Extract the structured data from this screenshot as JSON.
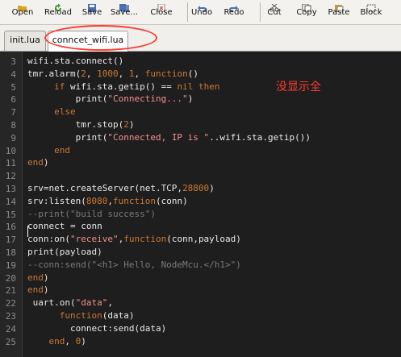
{
  "toolbar": {
    "buttons": [
      {
        "label": "Open",
        "icon": "folder-open-icon",
        "color": "#d9a520"
      },
      {
        "label": "Reload",
        "icon": "reload-icon",
        "color": "#3aa038"
      },
      {
        "label": "Save",
        "icon": "floppy-icon",
        "color": "#4a6fb0"
      },
      {
        "label": "Save...",
        "icon": "floppy-multi-icon",
        "color": "#4a6fb0"
      },
      {
        "label": "Close",
        "icon": "close-icon",
        "color": "#888888"
      },
      {
        "label": "Undo",
        "icon": "undo-icon",
        "color": "#4a6fb0"
      },
      {
        "label": "Redo",
        "icon": "redo-icon",
        "color": "#4a6fb0"
      },
      {
        "label": "Cut",
        "icon": "scissors-icon",
        "color": "#555555"
      },
      {
        "label": "Copy",
        "icon": "copy-icon",
        "color": "#555555"
      },
      {
        "label": "Paste",
        "icon": "paste-icon",
        "color": "#c99a3c"
      },
      {
        "label": "Block",
        "icon": "block-icon",
        "color": "#555555"
      }
    ]
  },
  "tabs": [
    {
      "label": "init.lua",
      "active": false
    },
    {
      "label": "conncet_wifi.lua",
      "active": true
    }
  ],
  "annotation": {
    "text": "没显示全",
    "color": "#ff3b30"
  },
  "editor": {
    "lines": [
      {
        "n": "3",
        "segs": [
          {
            "t": "wifi.sta.connect()",
            "c": "fn"
          }
        ]
      },
      {
        "n": "4",
        "segs": [
          {
            "t": "tmr.alarm(",
            "c": "fn"
          },
          {
            "t": "2",
            "c": "num"
          },
          {
            "t": ", ",
            "c": "fn"
          },
          {
            "t": "1000",
            "c": "num"
          },
          {
            "t": ", ",
            "c": "fn"
          },
          {
            "t": "1",
            "c": "num"
          },
          {
            "t": ", ",
            "c": "fn"
          },
          {
            "t": "function",
            "c": "kw"
          },
          {
            "t": "()",
            "c": "fn"
          }
        ]
      },
      {
        "n": "5",
        "segs": [
          {
            "t": "     ",
            "c": "fn"
          },
          {
            "t": "if",
            "c": "kw"
          },
          {
            "t": " wifi.sta.getip() == ",
            "c": "fn"
          },
          {
            "t": "nil",
            "c": "kw"
          },
          {
            "t": " ",
            "c": "fn"
          },
          {
            "t": "then",
            "c": "kw"
          }
        ]
      },
      {
        "n": "6",
        "segs": [
          {
            "t": "         print(",
            "c": "fn"
          },
          {
            "t": "\"Connecting...\"",
            "c": "str"
          },
          {
            "t": ")",
            "c": "fn"
          }
        ]
      },
      {
        "n": "7",
        "segs": [
          {
            "t": "     ",
            "c": "fn"
          },
          {
            "t": "else",
            "c": "kw"
          }
        ]
      },
      {
        "n": "8",
        "segs": [
          {
            "t": "         tmr.stop(",
            "c": "fn"
          },
          {
            "t": "2",
            "c": "num"
          },
          {
            "t": ")",
            "c": "fn"
          }
        ]
      },
      {
        "n": "9",
        "segs": [
          {
            "t": "         print(",
            "c": "fn"
          },
          {
            "t": "\"Connected, IP is \"",
            "c": "str"
          },
          {
            "t": "..wifi.sta.getip())",
            "c": "fn"
          }
        ]
      },
      {
        "n": "10",
        "segs": [
          {
            "t": "     ",
            "c": "fn"
          },
          {
            "t": "end",
            "c": "kw"
          }
        ]
      },
      {
        "n": "11",
        "segs": [
          {
            "t": "end",
            "c": "kw"
          },
          {
            "t": ")",
            "c": "fn"
          }
        ]
      },
      {
        "n": "12",
        "segs": [
          {
            "t": "",
            "c": "fn"
          }
        ]
      },
      {
        "n": "13",
        "segs": [
          {
            "t": "srv=net.createServer(net.TCP,",
            "c": "fn"
          },
          {
            "t": "28800",
            "c": "num"
          },
          {
            "t": ")",
            "c": "fn"
          }
        ]
      },
      {
        "n": "14",
        "segs": [
          {
            "t": "srv:listen(",
            "c": "fn"
          },
          {
            "t": "8080",
            "c": "num"
          },
          {
            "t": ",",
            "c": "fn"
          },
          {
            "t": "function",
            "c": "kw"
          },
          {
            "t": "(conn)",
            "c": "fn"
          }
        ]
      },
      {
        "n": "15",
        "segs": [
          {
            "t": "--print(\"build success\")",
            "c": "cmt"
          }
        ]
      },
      {
        "n": "16",
        "segs": [
          {
            "t": "connect = conn",
            "c": "fn"
          }
        ]
      },
      {
        "n": "17",
        "segs": [
          {
            "t": "conn:on(",
            "c": "fn"
          },
          {
            "t": "\"receive\"",
            "c": "str"
          },
          {
            "t": ",",
            "c": "fn"
          },
          {
            "t": "function",
            "c": "kw"
          },
          {
            "t": "(conn,payload)",
            "c": "fn"
          }
        ]
      },
      {
        "n": "18",
        "segs": [
          {
            "t": "print(payload)",
            "c": "fn"
          }
        ]
      },
      {
        "n": "19",
        "segs": [
          {
            "t": "--conn:send(\"<h1> Hello, NodeMcu.</h1>\")",
            "c": "cmt"
          }
        ]
      },
      {
        "n": "20",
        "segs": [
          {
            "t": "end",
            "c": "kw"
          },
          {
            "t": ")",
            "c": "fn"
          }
        ]
      },
      {
        "n": "21",
        "segs": [
          {
            "t": "end",
            "c": "kw"
          },
          {
            "t": ")",
            "c": "fn"
          }
        ]
      },
      {
        "n": "22",
        "segs": [
          {
            "t": " uart.on(",
            "c": "fn"
          },
          {
            "t": "\"data\"",
            "c": "str"
          },
          {
            "t": ",",
            "c": "fn"
          }
        ]
      },
      {
        "n": "23",
        "segs": [
          {
            "t": "      ",
            "c": "fn"
          },
          {
            "t": "function",
            "c": "kw"
          },
          {
            "t": "(data)",
            "c": "fn"
          }
        ]
      },
      {
        "n": "24",
        "segs": [
          {
            "t": "        connect:send(data)",
            "c": "fn"
          }
        ]
      },
      {
        "n": "25",
        "segs": [
          {
            "t": "    ",
            "c": "fn"
          },
          {
            "t": "end",
            "c": "kw"
          },
          {
            "t": ", ",
            "c": "fn"
          },
          {
            "t": "0",
            "c": "num"
          },
          {
            "t": ")",
            "c": "fn"
          }
        ]
      }
    ]
  }
}
